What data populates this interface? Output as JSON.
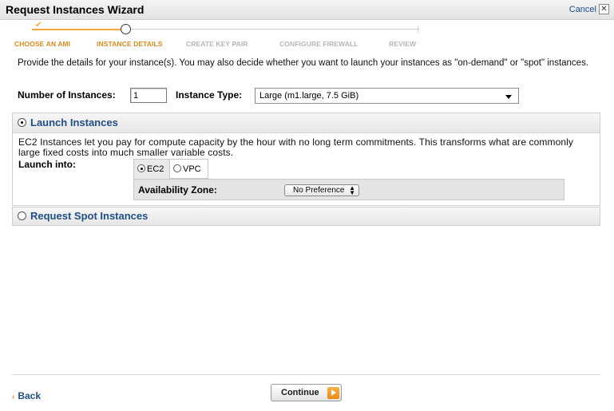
{
  "wizard": {
    "title": "Request Instances Wizard",
    "cancel_label": "Cancel",
    "cancel_icon": "close-icon"
  },
  "steps": [
    {
      "label": "CHOOSE AN AMI",
      "state": "done"
    },
    {
      "label": "INSTANCE DETAILS",
      "state": "active"
    },
    {
      "label": "CREATE KEY PAIR",
      "state": "todo"
    },
    {
      "label": "CONFIGURE FIREWALL",
      "state": "todo"
    },
    {
      "label": "REVIEW",
      "state": "todo"
    }
  ],
  "intro_text": "Provide the details for your instance(s). You may also decide whether you want to launch your instances as \"on-demand\" or \"spot\" instances.",
  "instances": {
    "number_label": "Number of Instances:",
    "number_value": "1",
    "type_label": "Instance Type:",
    "type_value": "Large (m1.large, 7.5 GiB)"
  },
  "launch_panel": {
    "title": "Launch Instances",
    "selected": true,
    "description": "EC2 Instances let you pay for compute capacity by the hour with no long term commitments. This transforms what are commonly large fixed costs into much smaller variable costs.",
    "launch_into_label": "Launch into:",
    "options": [
      {
        "label": "EC2",
        "selected": true
      },
      {
        "label": "VPC",
        "selected": false
      }
    ],
    "az_label": "Availability Zone:",
    "az_value": "No Preference"
  },
  "spot_panel": {
    "title": "Request Spot Instances",
    "selected": false
  },
  "footer": {
    "back_label": "Back",
    "continue_label": "Continue"
  },
  "colors": {
    "accent_orange": "#e88a12",
    "link_blue": "#1f4f86"
  }
}
